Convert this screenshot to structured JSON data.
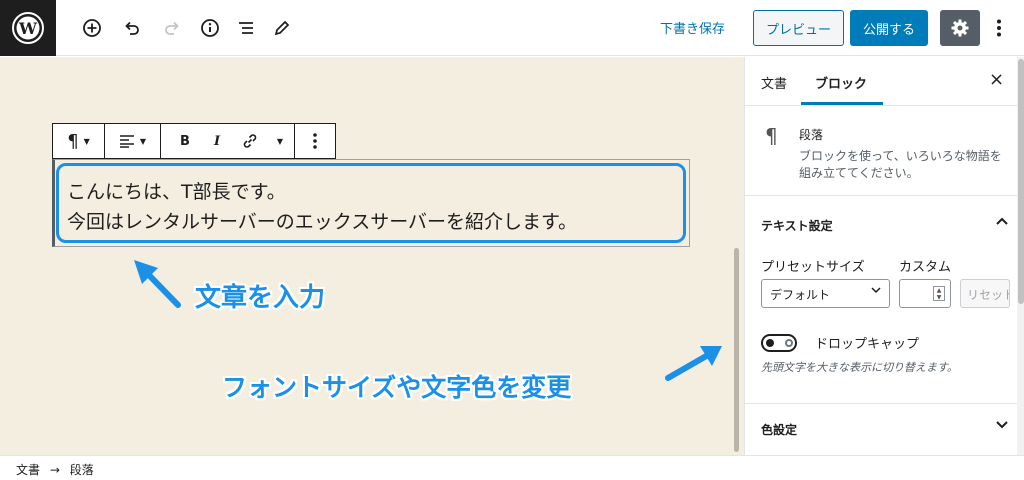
{
  "toolbar": {
    "save_draft": "下書き保存",
    "preview": "プレビュー",
    "publish": "公開する"
  },
  "block_toolbar": {
    "bold": "B",
    "italic": "I"
  },
  "paragraph": {
    "line1": "こんにちは、T部長です。",
    "line2": "今回はレンタルサーバーのエックスサーバーを紹介します。"
  },
  "annotations": {
    "input_text": "文章を入力",
    "change_font": "フォントサイズや文字色を変更"
  },
  "sidebar": {
    "tab_document": "文書",
    "tab_block": "ブロック",
    "close": "×",
    "block_name": "段落",
    "block_desc": "ブロックを使って、いろいろな物語を組み立ててください。",
    "text_settings": {
      "title": "テキスト設定",
      "preset_label": "プリセットサイズ",
      "custom_label": "カスタム",
      "preset_value": "デフォルト",
      "reset": "リセット",
      "drop_cap": "ドロップキャップ",
      "drop_cap_help": "先頭文字を大きな表示に切り替えます。"
    },
    "color_settings": {
      "title": "色設定"
    }
  },
  "footer": {
    "crumb_1": "文書",
    "arrow": "→",
    "crumb_2": "段落"
  },
  "colors": {
    "accent": "#007cba",
    "annotation": "#1a90e6",
    "canvas": "#f3eedf"
  }
}
